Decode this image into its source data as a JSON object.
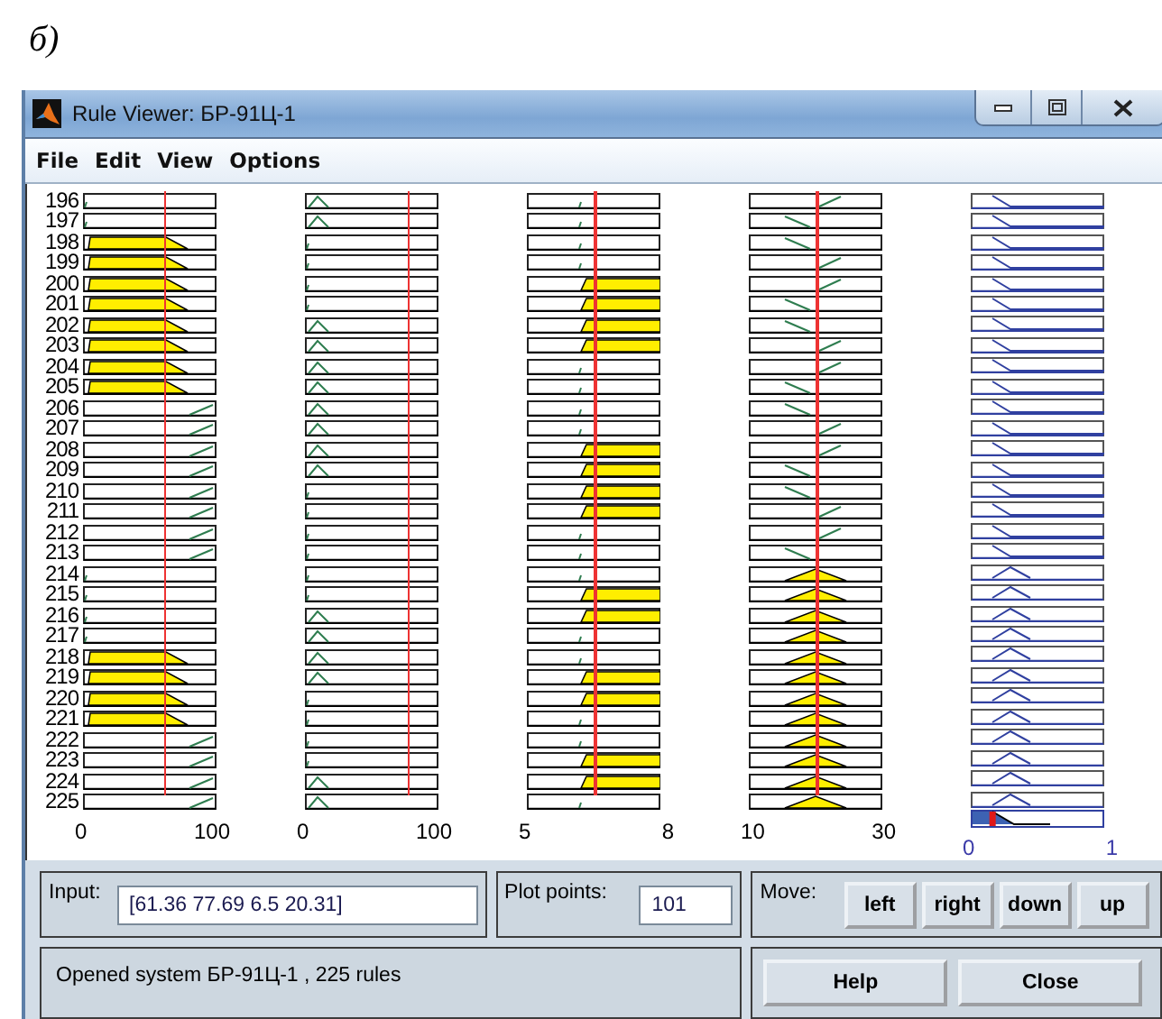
{
  "caption": "б)",
  "window": {
    "title": "Rule Viewer: БР-91Ц-1"
  },
  "menu": [
    "File",
    "Edit",
    "View",
    "Options"
  ],
  "columns": [
    {
      "kind": "input",
      "min": "0",
      "max": "100"
    },
    {
      "kind": "input",
      "min": "0",
      "max": "100"
    },
    {
      "kind": "input",
      "min": "5",
      "max": "8"
    },
    {
      "kind": "input",
      "min": "10",
      "max": "30"
    },
    {
      "kind": "output",
      "min": "0",
      "max": "1",
      "level": 0.16
    }
  ],
  "rules": [
    {
      "number": "196",
      "cells": [
        {
          "kind": "left",
          "fired": false
        },
        {
          "kind": "mid",
          "fired": false
        },
        {
          "kind": "right",
          "fired": false
        },
        {
          "kind": "right",
          "fired": false
        },
        {
          "kind": "left",
          "fired": false
        }
      ]
    },
    {
      "number": "197",
      "cells": [
        {
          "kind": "left",
          "fired": false
        },
        {
          "kind": "mid",
          "fired": false
        },
        {
          "kind": "right",
          "fired": false
        },
        {
          "kind": "left",
          "fired": false
        },
        {
          "kind": "left",
          "fired": false
        }
      ]
    },
    {
      "number": "198",
      "cells": [
        {
          "kind": "left",
          "fired": true
        },
        {
          "kind": "left",
          "fired": false
        },
        {
          "kind": "right",
          "fired": false
        },
        {
          "kind": "left",
          "fired": false
        },
        {
          "kind": "left",
          "fired": false
        }
      ]
    },
    {
      "number": "199",
      "cells": [
        {
          "kind": "left",
          "fired": true
        },
        {
          "kind": "left",
          "fired": false
        },
        {
          "kind": "right",
          "fired": false
        },
        {
          "kind": "right",
          "fired": false
        },
        {
          "kind": "left",
          "fired": false
        }
      ]
    },
    {
      "number": "200",
      "cells": [
        {
          "kind": "left",
          "fired": true
        },
        {
          "kind": "left",
          "fired": false
        },
        {
          "kind": "right",
          "fired": true
        },
        {
          "kind": "right",
          "fired": false
        },
        {
          "kind": "left",
          "fired": false
        }
      ]
    },
    {
      "number": "201",
      "cells": [
        {
          "kind": "left",
          "fired": true
        },
        {
          "kind": "left",
          "fired": false
        },
        {
          "kind": "right",
          "fired": true
        },
        {
          "kind": "left",
          "fired": false
        },
        {
          "kind": "left",
          "fired": false
        }
      ]
    },
    {
      "number": "202",
      "cells": [
        {
          "kind": "left",
          "fired": true
        },
        {
          "kind": "mid",
          "fired": false
        },
        {
          "kind": "right",
          "fired": true
        },
        {
          "kind": "left",
          "fired": false
        },
        {
          "kind": "left",
          "fired": false
        }
      ]
    },
    {
      "number": "203",
      "cells": [
        {
          "kind": "left",
          "fired": true
        },
        {
          "kind": "mid",
          "fired": false
        },
        {
          "kind": "right",
          "fired": true
        },
        {
          "kind": "right",
          "fired": false
        },
        {
          "kind": "left",
          "fired": false
        }
      ]
    },
    {
      "number": "204",
      "cells": [
        {
          "kind": "left",
          "fired": true
        },
        {
          "kind": "mid",
          "fired": false
        },
        {
          "kind": "right",
          "fired": false
        },
        {
          "kind": "right",
          "fired": false
        },
        {
          "kind": "left",
          "fired": false
        }
      ]
    },
    {
      "number": "205",
      "cells": [
        {
          "kind": "left",
          "fired": true
        },
        {
          "kind": "mid",
          "fired": false
        },
        {
          "kind": "right",
          "fired": false
        },
        {
          "kind": "left",
          "fired": false
        },
        {
          "kind": "left",
          "fired": false
        }
      ]
    },
    {
      "number": "206",
      "cells": [
        {
          "kind": "right",
          "fired": false
        },
        {
          "kind": "mid",
          "fired": false
        },
        {
          "kind": "right",
          "fired": false
        },
        {
          "kind": "left",
          "fired": false
        },
        {
          "kind": "left",
          "fired": false
        }
      ]
    },
    {
      "number": "207",
      "cells": [
        {
          "kind": "right",
          "fired": false
        },
        {
          "kind": "mid",
          "fired": false
        },
        {
          "kind": "right",
          "fired": false
        },
        {
          "kind": "right",
          "fired": false
        },
        {
          "kind": "left",
          "fired": false
        }
      ]
    },
    {
      "number": "208",
      "cells": [
        {
          "kind": "right",
          "fired": false
        },
        {
          "kind": "mid",
          "fired": false
        },
        {
          "kind": "right",
          "fired": true
        },
        {
          "kind": "right",
          "fired": false
        },
        {
          "kind": "left",
          "fired": false
        }
      ]
    },
    {
      "number": "209",
      "cells": [
        {
          "kind": "right",
          "fired": false
        },
        {
          "kind": "mid",
          "fired": false
        },
        {
          "kind": "right",
          "fired": true
        },
        {
          "kind": "left",
          "fired": false
        },
        {
          "kind": "left",
          "fired": false
        }
      ]
    },
    {
      "number": "210",
      "cells": [
        {
          "kind": "right",
          "fired": false
        },
        {
          "kind": "left",
          "fired": false
        },
        {
          "kind": "right",
          "fired": true
        },
        {
          "kind": "left",
          "fired": false
        },
        {
          "kind": "left",
          "fired": false
        }
      ]
    },
    {
      "number": "211",
      "cells": [
        {
          "kind": "right",
          "fired": false
        },
        {
          "kind": "left",
          "fired": false
        },
        {
          "kind": "right",
          "fired": true
        },
        {
          "kind": "right",
          "fired": false
        },
        {
          "kind": "left",
          "fired": false
        }
      ]
    },
    {
      "number": "212",
      "cells": [
        {
          "kind": "right",
          "fired": false
        },
        {
          "kind": "left",
          "fired": false
        },
        {
          "kind": "right",
          "fired": false
        },
        {
          "kind": "right",
          "fired": false
        },
        {
          "kind": "left",
          "fired": false
        }
      ]
    },
    {
      "number": "213",
      "cells": [
        {
          "kind": "right",
          "fired": false
        },
        {
          "kind": "left",
          "fired": false
        },
        {
          "kind": "right",
          "fired": false
        },
        {
          "kind": "left",
          "fired": false
        },
        {
          "kind": "left",
          "fired": false
        }
      ]
    },
    {
      "number": "214",
      "cells": [
        {
          "kind": "left",
          "fired": false
        },
        {
          "kind": "left",
          "fired": false
        },
        {
          "kind": "right",
          "fired": false
        },
        {
          "kind": "mid",
          "fired": true
        },
        {
          "kind": "mid",
          "fired": false
        }
      ]
    },
    {
      "number": "215",
      "cells": [
        {
          "kind": "left",
          "fired": false
        },
        {
          "kind": "left",
          "fired": false
        },
        {
          "kind": "right",
          "fired": true
        },
        {
          "kind": "mid",
          "fired": true
        },
        {
          "kind": "mid",
          "fired": false
        }
      ]
    },
    {
      "number": "216",
      "cells": [
        {
          "kind": "left",
          "fired": false
        },
        {
          "kind": "mid",
          "fired": false
        },
        {
          "kind": "right",
          "fired": true
        },
        {
          "kind": "mid",
          "fired": true
        },
        {
          "kind": "mid",
          "fired": false
        }
      ]
    },
    {
      "number": "217",
      "cells": [
        {
          "kind": "left",
          "fired": false
        },
        {
          "kind": "mid",
          "fired": false
        },
        {
          "kind": "right",
          "fired": false
        },
        {
          "kind": "mid",
          "fired": true
        },
        {
          "kind": "mid",
          "fired": false
        }
      ]
    },
    {
      "number": "218",
      "cells": [
        {
          "kind": "left",
          "fired": true
        },
        {
          "kind": "mid",
          "fired": false
        },
        {
          "kind": "right",
          "fired": false
        },
        {
          "kind": "mid",
          "fired": true
        },
        {
          "kind": "mid",
          "fired": false
        }
      ]
    },
    {
      "number": "219",
      "cells": [
        {
          "kind": "left",
          "fired": true
        },
        {
          "kind": "mid",
          "fired": false
        },
        {
          "kind": "right",
          "fired": true
        },
        {
          "kind": "mid",
          "fired": true
        },
        {
          "kind": "mid",
          "fired": false
        }
      ]
    },
    {
      "number": "220",
      "cells": [
        {
          "kind": "left",
          "fired": true
        },
        {
          "kind": "left",
          "fired": false
        },
        {
          "kind": "right",
          "fired": true
        },
        {
          "kind": "mid",
          "fired": true
        },
        {
          "kind": "mid",
          "fired": false
        }
      ]
    },
    {
      "number": "221",
      "cells": [
        {
          "kind": "left",
          "fired": true
        },
        {
          "kind": "left",
          "fired": false
        },
        {
          "kind": "right",
          "fired": false
        },
        {
          "kind": "mid",
          "fired": true
        },
        {
          "kind": "mid",
          "fired": false
        }
      ]
    },
    {
      "number": "222",
      "cells": [
        {
          "kind": "right",
          "fired": false
        },
        {
          "kind": "left",
          "fired": false
        },
        {
          "kind": "right",
          "fired": false
        },
        {
          "kind": "mid",
          "fired": true
        },
        {
          "kind": "mid",
          "fired": false
        }
      ]
    },
    {
      "number": "223",
      "cells": [
        {
          "kind": "right",
          "fired": false
        },
        {
          "kind": "left",
          "fired": false
        },
        {
          "kind": "right",
          "fired": true
        },
        {
          "kind": "mid",
          "fired": true
        },
        {
          "kind": "mid",
          "fired": false
        }
      ]
    },
    {
      "number": "224",
      "cells": [
        {
          "kind": "right",
          "fired": false
        },
        {
          "kind": "mid",
          "fired": false
        },
        {
          "kind": "right",
          "fired": true
        },
        {
          "kind": "mid",
          "fired": true
        },
        {
          "kind": "mid",
          "fired": false
        }
      ]
    },
    {
      "number": "225",
      "cells": [
        {
          "kind": "right",
          "fired": false
        },
        {
          "kind": "mid",
          "fired": false
        },
        {
          "kind": "right",
          "fired": false
        },
        {
          "kind": "mid",
          "fired": true
        },
        {
          "kind": "mid",
          "fired": false
        }
      ]
    }
  ],
  "input": {
    "label": "Input:",
    "value": "[61.36 77.69 6.5 20.31]"
  },
  "plot_points": {
    "label": "Plot points:",
    "value": "101"
  },
  "move": {
    "label": "Move:",
    "buttons": [
      "left",
      "right",
      "down",
      "up"
    ]
  },
  "status": "Opened system БР-91Ц-1 , 225 rules",
  "buttons": [
    "Help",
    "Close"
  ]
}
